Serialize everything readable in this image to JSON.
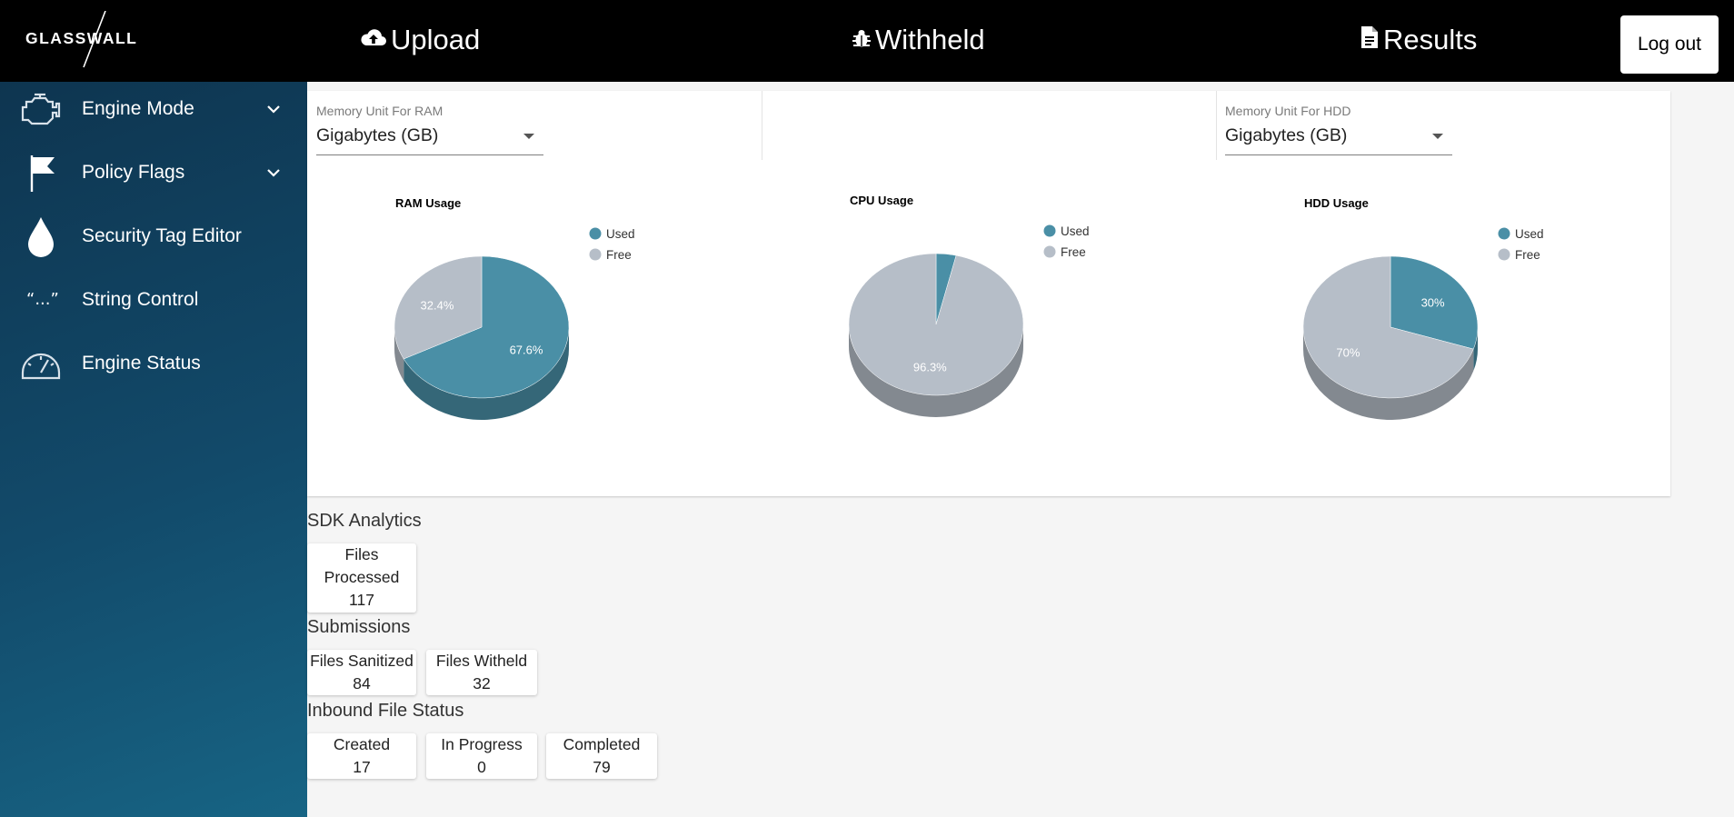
{
  "header": {
    "logo_text": "GLASSWALL",
    "nav": [
      {
        "label": "Upload",
        "icon": "cloud-upload-icon"
      },
      {
        "label": "Withheld",
        "icon": "bug-icon"
      },
      {
        "label": "Results",
        "icon": "file-text-icon"
      }
    ],
    "logout_label": "Log out"
  },
  "sidebar": {
    "items": [
      {
        "label": "Engine Mode",
        "icon": "engine-icon",
        "expandable": true
      },
      {
        "label": "Policy Flags",
        "icon": "flag-icon",
        "expandable": true
      },
      {
        "label": "Security Tag Editor",
        "icon": "droplet-icon",
        "expandable": false
      },
      {
        "label": "String Control",
        "icon": "quote-icon",
        "expandable": false
      },
      {
        "label": "Engine Status",
        "icon": "gauge-icon",
        "expandable": false
      }
    ]
  },
  "memory": {
    "ram": {
      "label": "Memory Unit For RAM",
      "value": "Gigabytes (GB)"
    },
    "hdd": {
      "label": "Memory Unit For HDD",
      "value": "Gigabytes (GB)"
    }
  },
  "colors": {
    "used": "#4a8fa6",
    "free": "#b6bec8"
  },
  "chart_data": [
    {
      "type": "pie",
      "title": "RAM Usage",
      "legend": "top-right",
      "labels": [
        "Used",
        "Free"
      ],
      "values": [
        67.6,
        32.4
      ],
      "value_labels": [
        "67.6%",
        "32.4%"
      ]
    },
    {
      "type": "pie",
      "title": "CPU Usage",
      "legend": "top-right",
      "labels": [
        "Used",
        "Free"
      ],
      "values": [
        3.7,
        96.3
      ],
      "value_labels": [
        "",
        "96.3%"
      ]
    },
    {
      "type": "pie",
      "title": "HDD Usage",
      "legend": "top-right",
      "labels": [
        "Used",
        "Free"
      ],
      "values": [
        30,
        70
      ],
      "value_labels": [
        "30%",
        "70%"
      ]
    }
  ],
  "sdk_analytics": {
    "title": "SDK Analytics",
    "stats": [
      {
        "label": "Files Processed",
        "value": "117"
      }
    ]
  },
  "submissions": {
    "title": "Submissions",
    "stats": [
      {
        "label": "Files Sanitized",
        "value": "84"
      },
      {
        "label": "Files Witheld",
        "value": "32"
      }
    ]
  },
  "inbound": {
    "title": "Inbound File Status",
    "stats": [
      {
        "label": "Created",
        "value": "17"
      },
      {
        "label": "In Progress",
        "value": "0"
      },
      {
        "label": "Completed",
        "value": "79"
      }
    ]
  }
}
